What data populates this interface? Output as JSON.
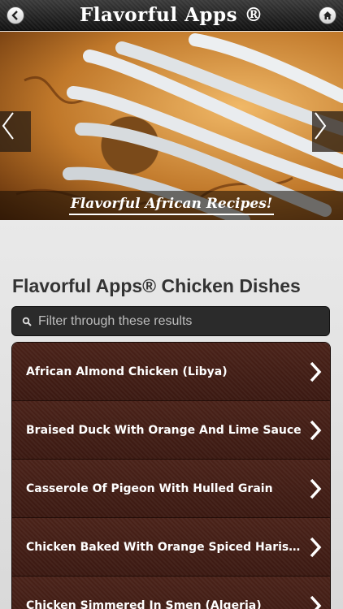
{
  "header": {
    "title": "Flavorful Apps ®"
  },
  "banner": {
    "caption": "Flavorful African Recipes!"
  },
  "main": {
    "title": "Flavorful Apps® Chicken Dishes",
    "search": {
      "placeholder": "Filter through these results",
      "value": ""
    },
    "items": [
      {
        "label": "African Almond Chicken (Libya)"
      },
      {
        "label": "Braised Duck With Orange And Lime Sauce"
      },
      {
        "label": "Casserole Of Pigeon With Hulled Grain"
      },
      {
        "label": "Chicken Baked With Orange Spiced Harissa Sauce"
      },
      {
        "label": "Chicken Simmered In Smen (Algeria)"
      }
    ]
  },
  "icons": {
    "back": "back-icon",
    "home": "home-icon",
    "prev": "chevron-left-icon",
    "next": "chevron-right-icon",
    "search": "search-icon",
    "item": "chevron-right-icon"
  }
}
